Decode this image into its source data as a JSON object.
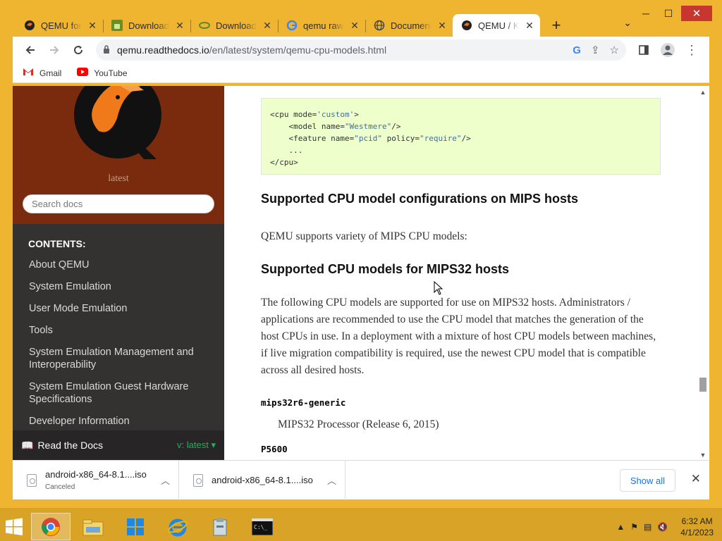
{
  "window": {
    "minimize": "─",
    "maximize": "☐",
    "close": "✕"
  },
  "tabs": [
    {
      "title": "QEMU for Windows",
      "favicon": "qemu-icon"
    },
    {
      "title": "Download Android",
      "favicon": "android-icon"
    },
    {
      "title": "Downloading",
      "favicon": "download-icon"
    },
    {
      "title": "qemu raw emulator",
      "favicon": "google-icon"
    },
    {
      "title": "Documentation",
      "favicon": "globe-icon"
    },
    {
      "title": "QEMU / KVM",
      "favicon": "qemu-icon"
    }
  ],
  "toolbar": {
    "url_host": "qemu.readthedocs.io",
    "url_path": "/en/latest/system/qemu-cpu-models.html"
  },
  "bookmarks": [
    {
      "label": "Gmail",
      "icon": "gmail-icon"
    },
    {
      "label": "YouTube",
      "icon": "youtube-icon"
    }
  ],
  "sidebar": {
    "version": "latest",
    "search_placeholder": "Search docs",
    "contents_caption": "CONTENTS:",
    "items": [
      "About QEMU",
      "System Emulation",
      "User Mode Emulation",
      "Tools",
      "System Emulation Management and Interoperability",
      "System Emulation Guest Hardware Specifications",
      "Developer Information"
    ],
    "rtd_label": "Read the Docs",
    "rtd_version": "v: latest"
  },
  "main": {
    "code_lines": [
      {
        "pre": "<cpu mode=",
        "str": "'custom'",
        "post": ">"
      },
      {
        "pre": "    <model name=",
        "str": "\"Westmere\"",
        "post": "/>"
      },
      {
        "pre": "    <feature name=",
        "str": "\"pcid\"",
        "mid": " policy=",
        "str2": "\"require\"",
        "post": "/>"
      },
      {
        "pre": "    ...",
        "str": "",
        "post": ""
      },
      {
        "pre": "</cpu>",
        "str": "",
        "post": ""
      }
    ],
    "heading_mips_hosts": "Supported CPU model configurations on MIPS hosts",
    "intro_mips": "QEMU supports variety of MIPS CPU models:",
    "heading_mips32": "Supported CPU models for MIPS32 hosts",
    "para_mips32": "The following CPU models are supported for use on MIPS32 hosts. Administrators / applications are recommended to use the CPU model that matches the generation of the host CPUs in use. In a deployment with a mixture of host CPU models between machines, if live migration compatibility is required, use the newest CPU model that is compatible across all desired hosts.",
    "term1": "mips32r6-generic",
    "def1": "MIPS32 Processor (Release 6, 2015)",
    "term2": "P5600"
  },
  "downloads": {
    "items": [
      {
        "name": "android-x86_64-8.1....iso",
        "status": "Canceled"
      },
      {
        "name": "android-x86_64-8.1....iso",
        "status": ""
      }
    ],
    "show_all": "Show all"
  },
  "taskbar": {
    "apps": [
      "chrome-icon",
      "file-explorer-icon",
      "store-icon",
      "internet-explorer-icon",
      "archive-icon",
      "command-prompt-icon"
    ],
    "time": "6:32 AM",
    "date": "4/1/2023"
  },
  "colors": {
    "frame": "#f0b530",
    "sidebar_top": "#7a2b0e",
    "sidebar": "#343131",
    "code_bg": "#eeffcc",
    "link_blue": "#1a73e8"
  }
}
